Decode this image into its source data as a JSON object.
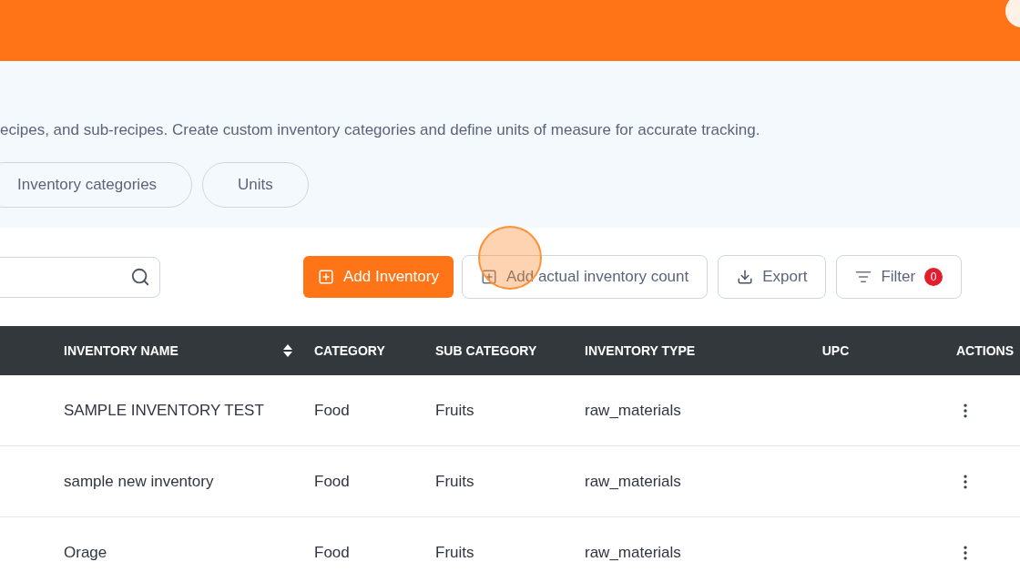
{
  "intro": {
    "description": "ecipes, and sub-recipes. Create custom inventory categories and define units of measure for accurate tracking.",
    "links": [
      "Inventory categories",
      "Units"
    ]
  },
  "toolbar": {
    "primary_button": "Add Inventory",
    "buttons": [
      {
        "kind": "plus",
        "label": "Add actual inventory count"
      },
      {
        "kind": "download",
        "label": "Export"
      },
      {
        "kind": "filter",
        "label": "Filter",
        "badge": "0"
      }
    ]
  },
  "table": {
    "columns": [
      "INVENTORY NAME",
      "CATEGORY",
      "SUB CATEGORY",
      "INVENTORY TYPE",
      "UPC",
      "ACTIONS"
    ],
    "rows": [
      {
        "name": "SAMPLE INVENTORY TEST",
        "category": "Food",
        "sub_category": "Fruits",
        "type": "raw_materials"
      },
      {
        "name": "sample new inventory",
        "category": "Food",
        "sub_category": "Fruits",
        "type": "raw_materials"
      },
      {
        "name": "Orage",
        "category": "Food",
        "sub_category": "Fruits",
        "type": "raw_materials"
      }
    ]
  }
}
